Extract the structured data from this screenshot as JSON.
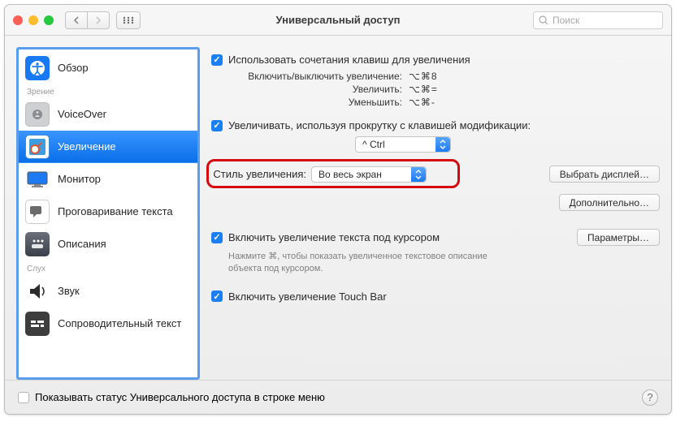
{
  "window": {
    "title": "Универсальный доступ"
  },
  "search": {
    "placeholder": "Поиск"
  },
  "sidebar": {
    "section1": "Зрение",
    "section2": "Слух",
    "items": [
      {
        "label": "Обзор"
      },
      {
        "label": "VoiceOver"
      },
      {
        "label": "Увеличение"
      },
      {
        "label": "Монитор"
      },
      {
        "label": "Проговаривание текста"
      },
      {
        "label": "Описания"
      },
      {
        "label": "Звук"
      },
      {
        "label": "Сопроводительный текст"
      }
    ]
  },
  "main": {
    "cb_shortcuts": "Использовать сочетания клавиш для увеличения",
    "kv": [
      {
        "label": "Включить/выключить увеличение:",
        "value": "⌥⌘8"
      },
      {
        "label": "Увеличить:",
        "value": "⌥⌘="
      },
      {
        "label": "Уменьшить:",
        "value": "⌥⌘-"
      }
    ],
    "cb_scroll": "Увеличивать, используя прокрутку с клавишей модификации:",
    "modifier": "^ Ctrl",
    "style_label": "Стиль увеличения:",
    "style_value": "Во весь экран",
    "choose_display": "Выбрать дисплей…",
    "advanced": "Дополнительно…",
    "cb_hover": "Включить увеличение текста под курсором",
    "options": "Параметры…",
    "hover_hint": "Нажмите ⌘, чтобы показать увеличенное текстовое описание объекта под курсором.",
    "cb_touchbar": "Включить увеличение Touch Bar"
  },
  "footer": {
    "show_status": "Показывать статус Универсального доступа в строке меню"
  }
}
